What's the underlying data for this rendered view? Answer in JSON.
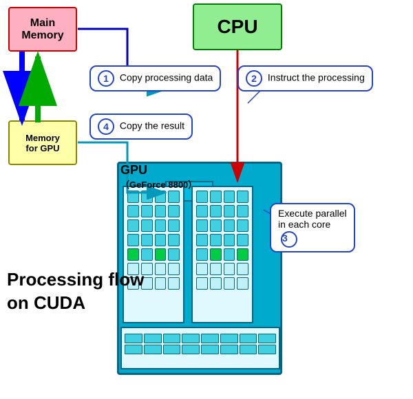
{
  "title": "Processing flow on CUDA",
  "boxes": {
    "main_memory": "Main Memory",
    "cpu": "CPU",
    "gpu_memory": "Memory\nfor GPU",
    "gpu_label": "GPU\n（GeForce 8800）"
  },
  "callouts": {
    "step1": "Copy processing data",
    "step2": "Instruct the processing",
    "step3": "Execute parallel\nin each core",
    "step4": "Copy the result"
  },
  "step_numbers": {
    "s1": "1",
    "s2": "2",
    "s3": "3",
    "s4": "4"
  },
  "processing_flow_line1": "Processing flow",
  "processing_flow_line2": "on CUDA"
}
